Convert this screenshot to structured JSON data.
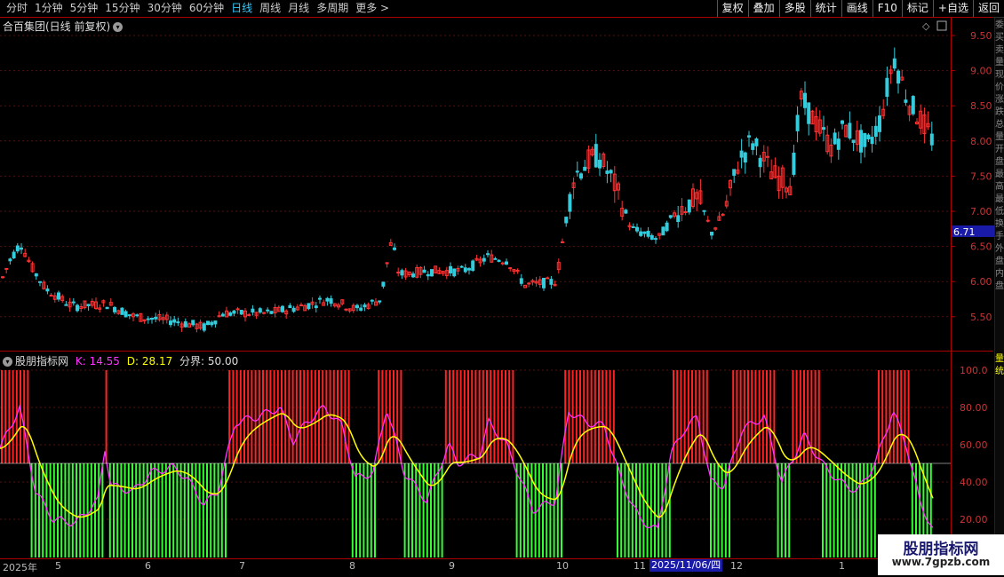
{
  "toolbar": {
    "tabs": [
      "分时",
      "1分钟",
      "5分钟",
      "15分钟",
      "30分钟",
      "60分钟",
      "日线",
      "周线",
      "月线",
      "多周期",
      "更多 >"
    ],
    "active_tab": "日线",
    "tools": [
      "复权",
      "叠加",
      "多股",
      "统计",
      "画线",
      "F10",
      "标记",
      "+自选",
      "返回"
    ]
  },
  "chart": {
    "title": "合百集团(日线 前复权)",
    "price_ticks": [
      "9.50",
      "9.00",
      "8.50",
      "8.00",
      "7.50",
      "7.00",
      "6.50",
      "6.00",
      "5.50"
    ],
    "current_price": "6.71",
    "up_color": "#ff3333",
    "down_color": "#33ccdd"
  },
  "indicator": {
    "name": "股朋指标网",
    "k_label": "K: 14.55",
    "d_label": "D: 28.17",
    "line_label": "分界: 50.00",
    "ticks": [
      "100.0",
      "80.00",
      "60.00",
      "40.00",
      "20.00"
    ],
    "k_color": "#ff33ff",
    "d_color": "#ffff00",
    "bar_up_color": "#ff2222",
    "bar_down_color": "#33ff33"
  },
  "axis": {
    "labels": [
      "2025年",
      "5",
      "6",
      "7",
      "8",
      "9",
      "10",
      "11",
      "12",
      "1"
    ],
    "cursor_date": "2025/11/06/四"
  },
  "sidebar_text": "委买卖量现价涨跌总量开盘最高最低换手外盘内盘",
  "sidebar_lower": "量统",
  "watermark": {
    "line1": "股朋指标网",
    "line2": "www.7gpzb.com"
  }
}
